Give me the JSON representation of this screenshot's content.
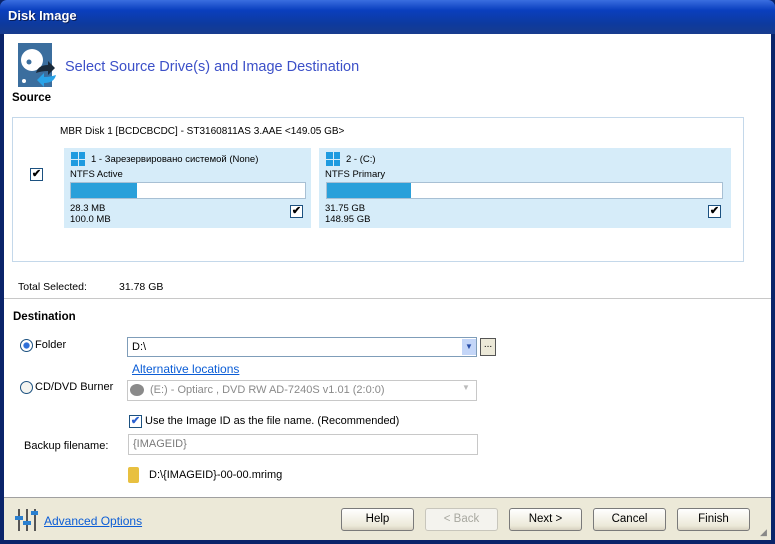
{
  "window": {
    "title": "Disk Image"
  },
  "header": {
    "title": "Select Source Drive(s) and Image Destination",
    "icon": "disk-image-icon"
  },
  "source": {
    "heading": "Source",
    "disk_label": "MBR Disk 1 [BCDCBCDC] - ST3160811AS 3.AAE  <149.05 GB>",
    "disk_checked": true,
    "partitions": [
      {
        "name": "1 - Зарезервировано системой (None)",
        "fs": "NTFS Active",
        "used": "28.3 MB",
        "total": "100.0 MB",
        "used_fraction": 0.283,
        "checked": true
      },
      {
        "name": "2 -  (C:)",
        "fs": "NTFS Primary",
        "used": "31.75 GB",
        "total": "148.95 GB",
        "used_fraction": 0.213,
        "checked": true
      }
    ],
    "total_label": "Total Selected:",
    "total_value": "31.78 GB"
  },
  "destination": {
    "heading": "Destination",
    "folder_label": "Folder",
    "folder_value": "D:\\",
    "browse_label": "...",
    "alt_link": "Alternative locations",
    "cd_label": "CD/DVD Burner",
    "cd_value": "(E:) - Optiarc , DVD RW AD-7240S  v1.01 (2:0:0)",
    "use_id_label": "Use the Image ID as the file name.  (Recommended)",
    "backup_label": "Backup filename:",
    "backup_value": "{IMAGEID}",
    "path": "D:\\{IMAGEID}-00-00.mrimg"
  },
  "footer": {
    "advanced": "Advanced Options",
    "help": "Help",
    "back": "< Back",
    "next": "Next >",
    "cancel": "Cancel",
    "finish": "Finish"
  }
}
